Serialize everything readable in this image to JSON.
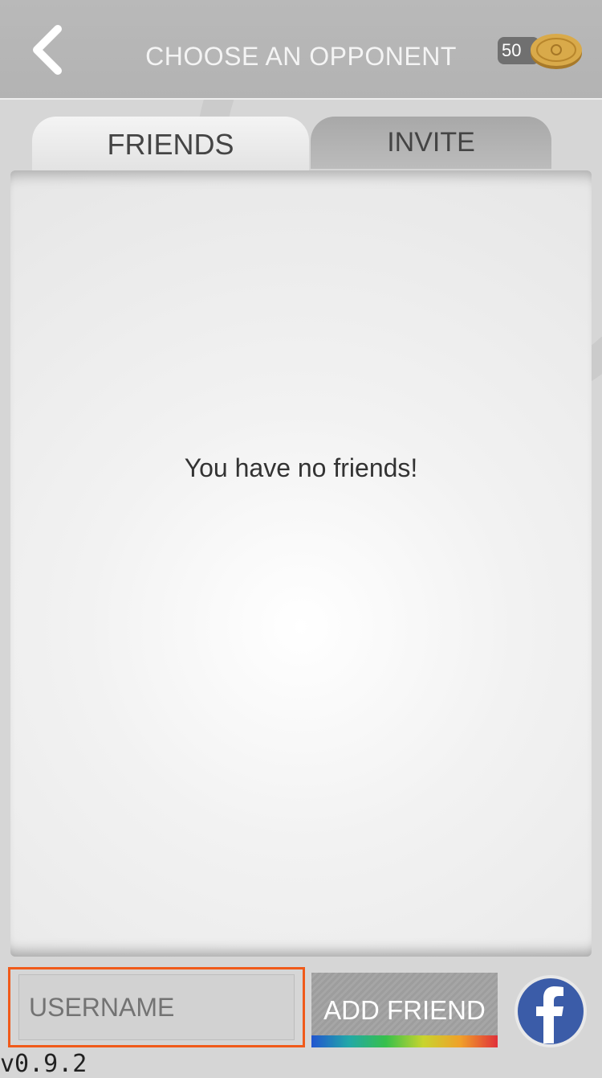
{
  "header": {
    "title": "CHOOSE AN OPPONENT",
    "coins": "50"
  },
  "tabs": [
    {
      "label": "FRIENDS",
      "active": true
    },
    {
      "label": "INVITE",
      "active": false
    }
  ],
  "main": {
    "empty_message": "You have no friends!"
  },
  "footer": {
    "username_placeholder": "USERNAME",
    "add_friend_label": "ADD FRIEND",
    "version": "v0.9.2"
  },
  "icons": {
    "back": "chevron-left-icon",
    "coin": "coin-icon",
    "facebook": "facebook-icon"
  },
  "colors": {
    "highlight": "#f05a1a",
    "facebook_blue": "#3b5ca8"
  }
}
